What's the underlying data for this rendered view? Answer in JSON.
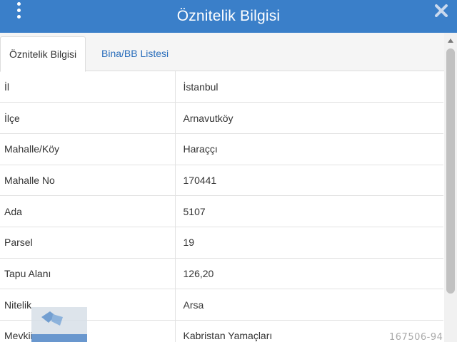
{
  "header": {
    "title": "Öznitelik Bilgisi",
    "menu_icon": "more-vertical-icon",
    "close_icon": "close-icon"
  },
  "tabs": [
    {
      "label": "Öznitelik Bilgisi",
      "active": true
    },
    {
      "label": "Bina/BB Listesi",
      "active": false
    }
  ],
  "rows": [
    {
      "key": "İl",
      "value": "İstanbul"
    },
    {
      "key": "İlçe",
      "value": "Arnavutköy"
    },
    {
      "key": "Mahalle/Köy",
      "value": "Haraççı"
    },
    {
      "key": "Mahalle No",
      "value": "170441"
    },
    {
      "key": "Ada",
      "value": "5107"
    },
    {
      "key": "Parsel",
      "value": "19"
    },
    {
      "key": "Tapu Alanı",
      "value": "126,20"
    },
    {
      "key": "Nitelik",
      "value": "Arsa"
    },
    {
      "key": "Mevkii",
      "value": "Kabristan Yamaçları"
    }
  ],
  "watermark": "167506-94",
  "colors": {
    "header": "#3a7fc9",
    "tab_link": "#2a6ebb"
  }
}
